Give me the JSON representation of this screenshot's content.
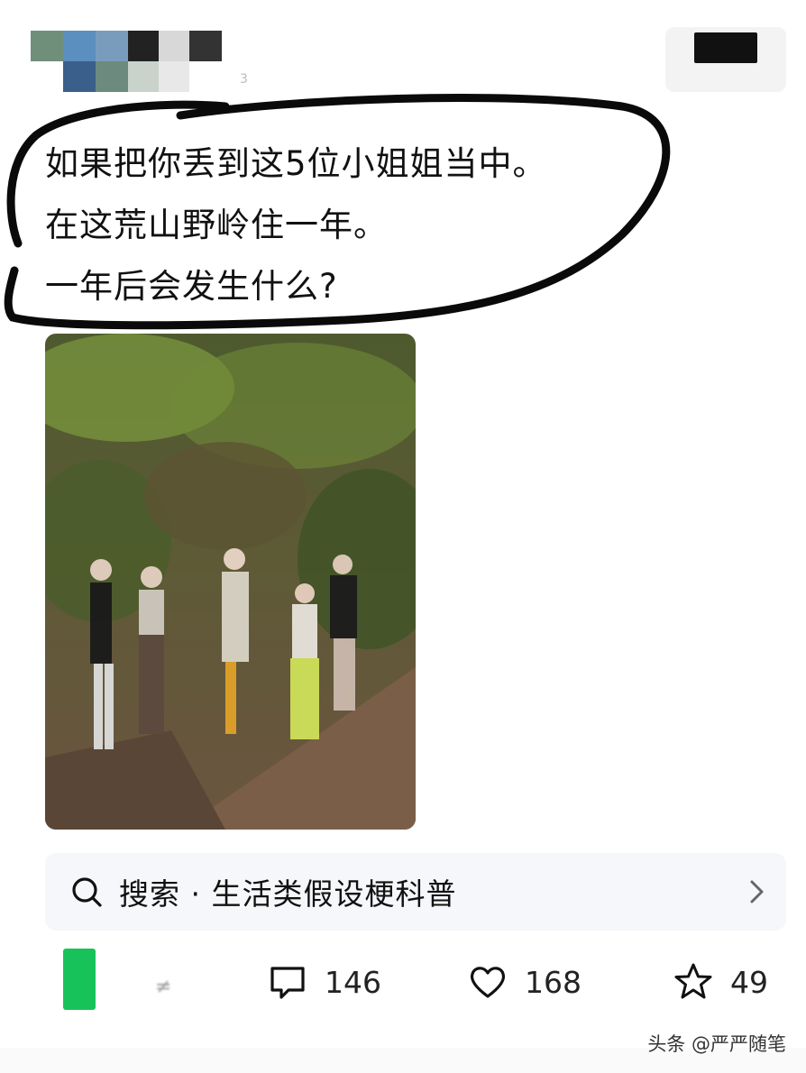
{
  "post": {
    "caption_lines": [
      "如果把你丢到这5位小姐姐当中。",
      "在这荒山野岭住一年。",
      "一年后会发生什么?"
    ],
    "time_fragment": "3"
  },
  "search": {
    "text": "搜索 · 生活类假设梗科普"
  },
  "actions": {
    "author_fragment": "≠",
    "comments": "146",
    "likes": "168",
    "favorites": "49"
  },
  "watermark": "头条 @严严随笔",
  "colors": {
    "accent_green": "#18c25a",
    "search_bg": "#f5f7fa"
  },
  "icons": [
    "search-icon",
    "chevron-right-icon",
    "comment-icon",
    "heart-icon",
    "star-icon"
  ]
}
